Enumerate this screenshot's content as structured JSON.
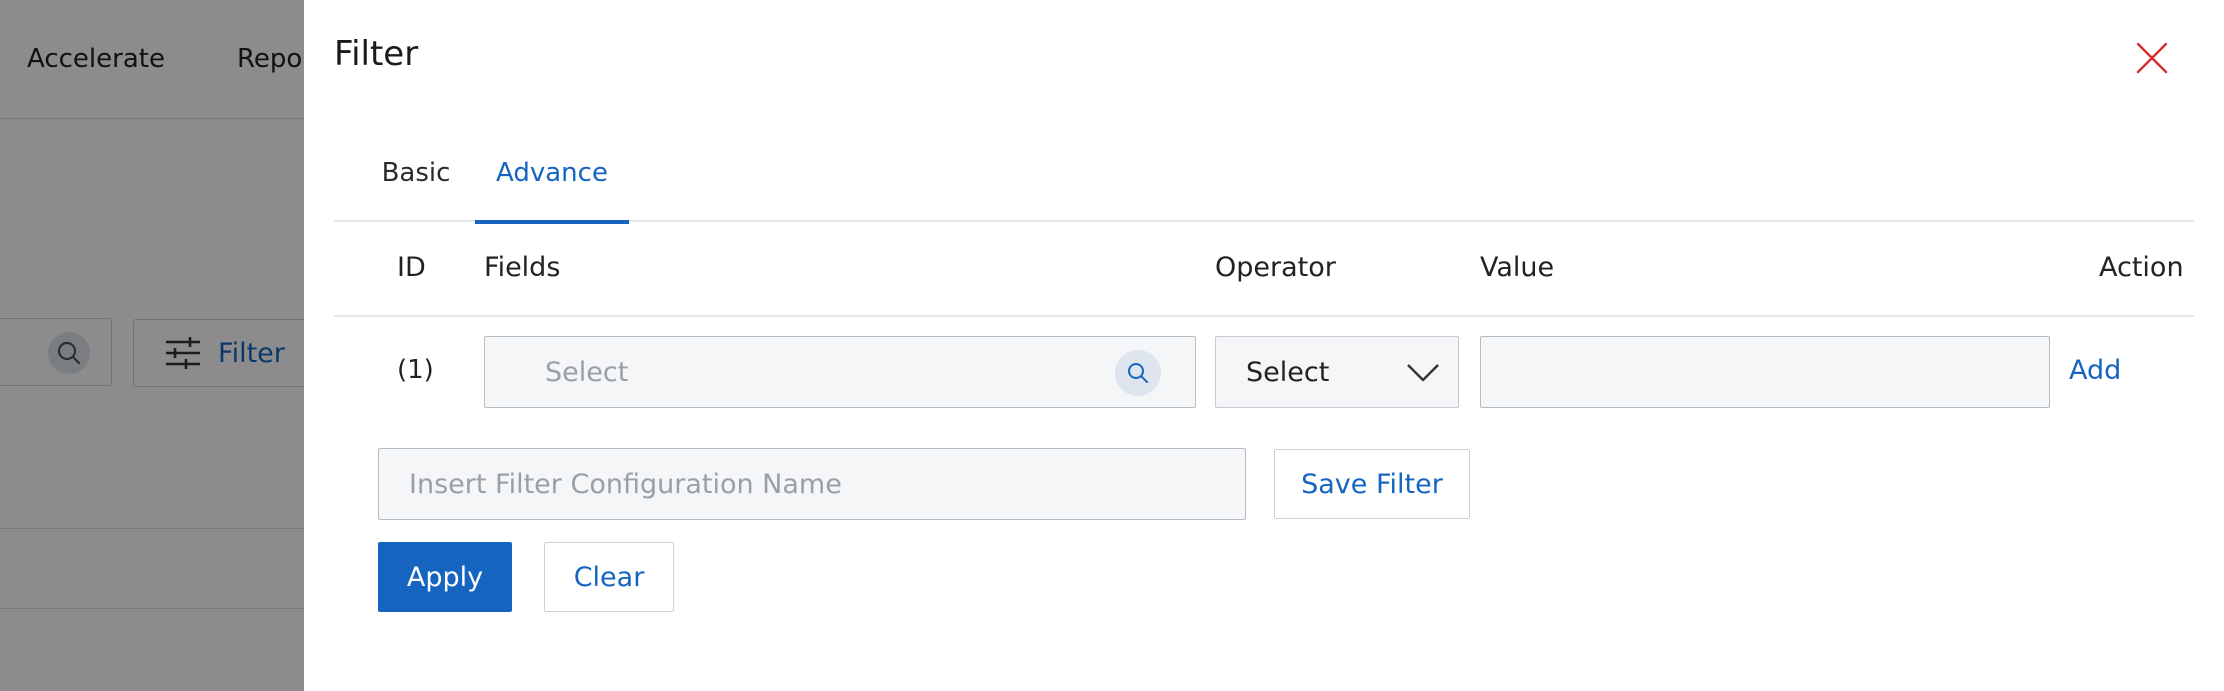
{
  "background": {
    "nav_items": [
      "Accelerate",
      "Repor"
    ],
    "filter_button_label": "Filter"
  },
  "drawer": {
    "title": "Filter",
    "tabs": [
      {
        "label": "Basic",
        "active": false
      },
      {
        "label": "Advance",
        "active": true
      }
    ],
    "columns": {
      "id": "ID",
      "fields": "Fields",
      "operator": "Operator",
      "value": "Value",
      "action": "Action"
    },
    "rows": [
      {
        "id": "(1)",
        "fields_placeholder": "Select",
        "operator_value": "Select",
        "value": "",
        "action_label": "Add"
      }
    ],
    "config_name_placeholder": "Insert Filter Configuration Name",
    "save_filter_label": "Save Filter",
    "apply_label": "Apply",
    "clear_label": "Clear"
  },
  "colors": {
    "accent": "#1565c0",
    "close_icon": "#d32f2f",
    "overlay": "rgba(0,0,0,0.45)"
  }
}
